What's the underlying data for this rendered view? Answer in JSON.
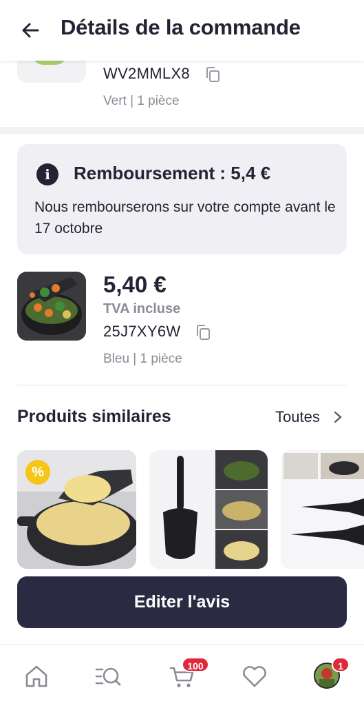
{
  "header": {
    "title": "Détails de la commande"
  },
  "item_top": {
    "sku": "WV2MMLX8",
    "variant": "Vert | 1 pièce"
  },
  "refund": {
    "title": "Remboursement : 5,4 €",
    "message": "Nous rembourserons sur votre compte avant le 17 octobre"
  },
  "item2": {
    "price": "5,40 €",
    "tax_note": "TVA incluse",
    "sku": "25J7XY6W",
    "variant": "Bleu | 1 pièce"
  },
  "similar": {
    "title": "Produits similaires",
    "see_all": "Toutes",
    "promo_badge": "%"
  },
  "cta": {
    "label": "Editer l'avis"
  },
  "nav": {
    "items": [
      "home-icon",
      "search-icon",
      "cart-icon",
      "heart-icon",
      "profile-avatar"
    ],
    "cart_badge": "100",
    "profile_badge": "1"
  },
  "colors": {
    "primary": "#2a2b42",
    "badge": "#e0283a",
    "promo": "#f5c518"
  }
}
